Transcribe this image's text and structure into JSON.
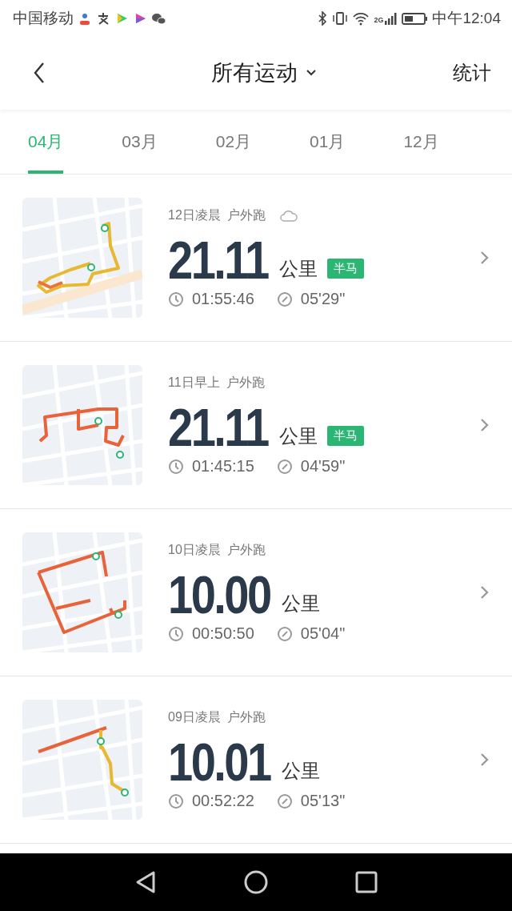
{
  "status_bar": {
    "carrier": "中国移动",
    "network": "2G",
    "time": "中午12:04"
  },
  "header": {
    "title": "所有运动",
    "action": "统计"
  },
  "tabs": [
    {
      "label": "04月",
      "selected": true
    },
    {
      "label": "03月",
      "selected": false
    },
    {
      "label": "02月",
      "selected": false
    },
    {
      "label": "01月",
      "selected": false
    },
    {
      "label": "12月",
      "selected": false
    }
  ],
  "runs": [
    {
      "when": "12日凌晨",
      "type": "户外跑",
      "cloudy": true,
      "distance": "21.11",
      "unit": "公里",
      "badge": "半马",
      "duration": "01:55:46",
      "pace": "05'29\""
    },
    {
      "when": "11日早上",
      "type": "户外跑",
      "cloudy": false,
      "distance": "21.11",
      "unit": "公里",
      "badge": "半马",
      "duration": "01:45:15",
      "pace": "04'59\""
    },
    {
      "when": "10日凌晨",
      "type": "户外跑",
      "cloudy": false,
      "distance": "10.00",
      "unit": "公里",
      "duration": "00:50:50",
      "pace": "05'04\""
    },
    {
      "when": "09日凌晨",
      "type": "户外跑",
      "cloudy": false,
      "distance": "10.01",
      "unit": "公里",
      "duration": "00:52:22",
      "pace": "05'13\""
    }
  ]
}
